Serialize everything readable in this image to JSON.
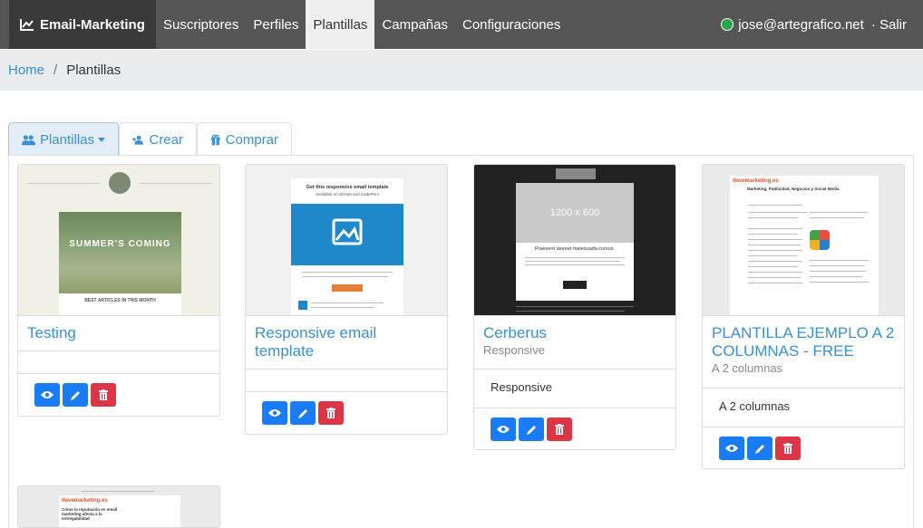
{
  "navbar": {
    "brand": "Email-Marketing",
    "items": [
      "Suscriptores",
      "Perfiles",
      "Plantillas",
      "Campañas",
      "Configuraciones"
    ],
    "user_email": "jose@artegrafico.net",
    "logout": "· Salir"
  },
  "breadcrumb": {
    "home": "Home",
    "separator": "/",
    "current": "Plantillas"
  },
  "tabs": {
    "plantillas": "Plantillas",
    "crear": "Crear",
    "comprar": "Comprar"
  },
  "cards": [
    {
      "title": "Testing",
      "subtitle": "",
      "description": "",
      "thumb_text": "SUMMER'S COMING",
      "thumb_caption": "BEST ARTICLES IN THIS MONTH"
    },
    {
      "title": "Responsive email template",
      "subtitle": "",
      "description": "",
      "thumb_text": "Get this responsive email template",
      "thumb_caption": "Available on GitHub and CodePen!"
    },
    {
      "title": "Cerberus",
      "subtitle": "Responsive",
      "description": "Responsive",
      "thumb_text": "1200 x 600",
      "thumb_caption": "Praesent laoreet malesuada cursus."
    },
    {
      "title": "PLANTILLA EJEMPLO A 2 COLUMNAS - FREE",
      "subtitle": "A 2 columnas",
      "description": "A 2 columnas",
      "thumb_text": "ilovemarketing.es",
      "thumb_caption": "Marketing, Publicidad, Negocios y Social Media"
    },
    {
      "title": "",
      "subtitle": "",
      "description": "",
      "thumb_text": "ilovemarketing.es",
      "thumb_caption": "Cómo la reputación en email marketing afecta a la entregabilidad"
    }
  ],
  "colors": {
    "accent": "#3a8fd8",
    "btn_blue": "#1a7cf5",
    "btn_red": "#dc3545",
    "navbar": "#555555"
  }
}
